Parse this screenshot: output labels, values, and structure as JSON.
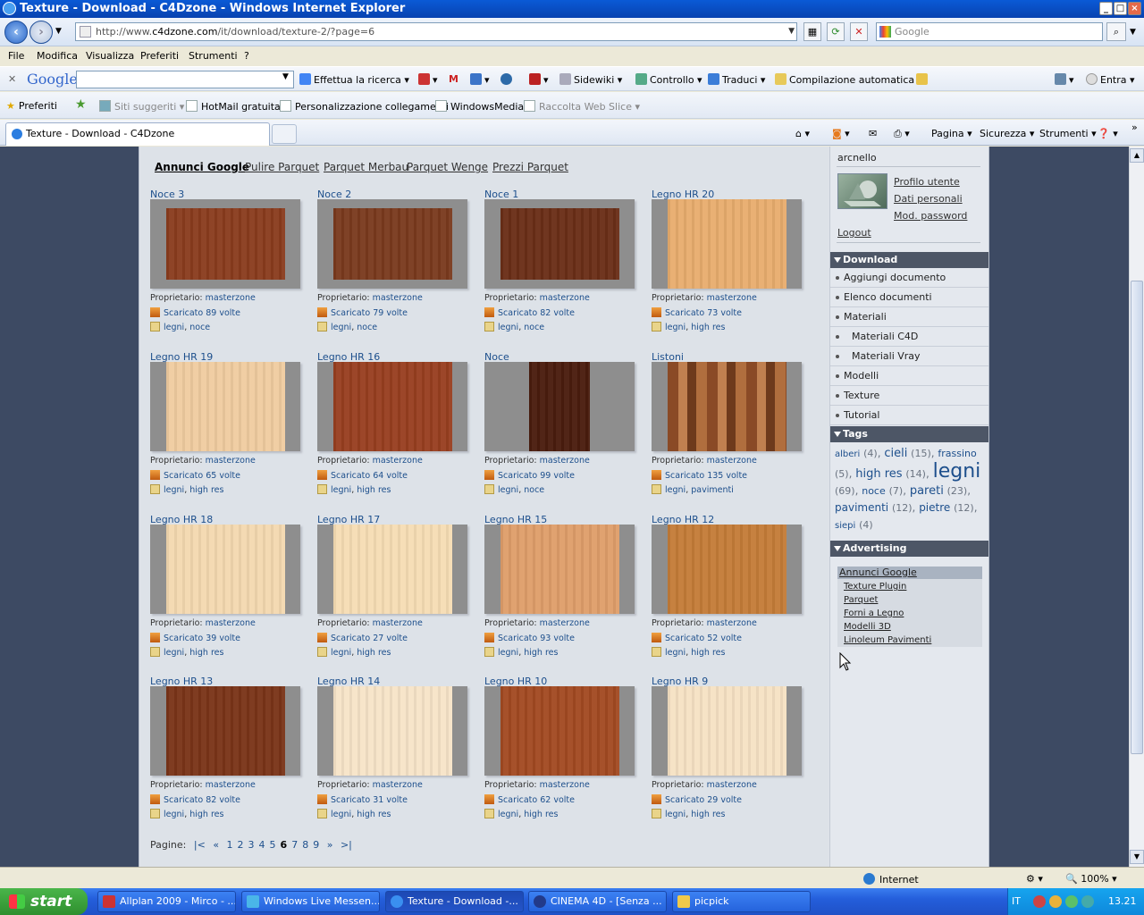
{
  "window": {
    "title": "Texture - Download - C4Dzone - Windows Internet Explorer"
  },
  "address": {
    "url_prefix": "http://www.",
    "url_domain": "c4dzone.com",
    "url_path": "/it/download/texture-2/?page=6",
    "search_placeholder": "Google"
  },
  "menu": [
    "File",
    "Modifica",
    "Visualizza",
    "Preferiti",
    "Strumenti",
    "?"
  ],
  "gtoolbar": {
    "logo": "Google",
    "search_label": "Effettua la ricerca",
    "sidewiki": "Sidewiki",
    "controllo": "Controllo",
    "traduci": "Traduci",
    "compilazione": "Compilazione automatica",
    "entra": "Entra"
  },
  "favbar": {
    "preferiti": "Preferiti",
    "siti": "Siti suggeriti",
    "hotmail": "HotMail gratuita",
    "personalizzazione": "Personalizzazione collegamenti",
    "windowsmedia": "WindowsMedia",
    "raccolta": "Raccolta Web Slice"
  },
  "tab": {
    "title": "Texture - Download - C4Dzone"
  },
  "commands": {
    "pagina": "Pagina",
    "sicurezza": "Sicurezza",
    "strumenti": "Strumenti"
  },
  "ads": {
    "label": "Annunci Google",
    "links": [
      "Pulire Parquet",
      "Parquet Merbau",
      "Parquet Wenge",
      "Prezzi Parquet"
    ]
  },
  "labels": {
    "owner": "Proprietario:",
    "owner_name": "masterzone"
  },
  "cards": [
    {
      "title": "Noce 3",
      "downloads": "Scaricato 89 volte",
      "tags": [
        "legni",
        "noce"
      ],
      "color": "#8a3c1e"
    },
    {
      "title": "Noce 2",
      "downloads": "Scaricato 79 volte",
      "tags": [
        "legni",
        "noce"
      ],
      "color": "#7a3a1e"
    },
    {
      "title": "Noce 1",
      "downloads": "Scaricato 82 volte",
      "tags": [
        "legni",
        "noce"
      ],
      "color": "#6a2e17"
    },
    {
      "title": "Legno HR 20",
      "downloads": "Scaricato 73 volte",
      "tags": [
        "legni",
        "high res"
      ],
      "color": "#e8ad6e"
    },
    {
      "title": "Legno HR 19",
      "downloads": "Scaricato 65 volte",
      "tags": [
        "legni",
        "high res"
      ],
      "color": "#f0cca0"
    },
    {
      "title": "Legno HR 16",
      "downloads": "Scaricato 64 volte",
      "tags": [
        "legni",
        "high res"
      ],
      "color": "#983f20"
    },
    {
      "title": "Noce",
      "downloads": "Scaricato 99 volte",
      "tags": [
        "legni",
        "noce"
      ],
      "color": "#4a1c0e"
    },
    {
      "title": "Listoni",
      "downloads": "Scaricato 135 volte",
      "tags": [
        "legni",
        "pavimenti"
      ],
      "color": "#a2643a"
    },
    {
      "title": "Legno HR 18",
      "downloads": "Scaricato 39 volte",
      "tags": [
        "legni",
        "high res"
      ],
      "color": "#f4d9b0"
    },
    {
      "title": "Legno HR 17",
      "downloads": "Scaricato 27 volte",
      "tags": [
        "legni",
        "high res"
      ],
      "color": "#f6ddb4"
    },
    {
      "title": "Legno HR 15",
      "downloads": "Scaricato 93 volte",
      "tags": [
        "legni",
        "high res"
      ],
      "color": "#df9e6a"
    },
    {
      "title": "Legno HR 12",
      "downloads": "Scaricato 52 volte",
      "tags": [
        "legni",
        "high res"
      ],
      "color": "#c47c38"
    },
    {
      "title": "Legno HR 13",
      "downloads": "Scaricato 82 volte",
      "tags": [
        "legni",
        "high res"
      ],
      "color": "#7a3418"
    },
    {
      "title": "Legno HR 14",
      "downloads": "Scaricato 31 volte",
      "tags": [
        "legni",
        "high res"
      ],
      "color": "#f7e4c8"
    },
    {
      "title": "Legno HR 10",
      "downloads": "Scaricato 62 volte",
      "tags": [
        "legni",
        "high res"
      ],
      "color": "#a24a22"
    },
    {
      "title": "Legno HR 9",
      "downloads": "Scaricato 29 volte",
      "tags": [
        "legni",
        "high res"
      ],
      "color": "#f6e2c4"
    }
  ],
  "pager": {
    "label": "Pagine:",
    "first": "|<",
    "prev": "«",
    "pages": [
      "1",
      "2",
      "3",
      "4",
      "5",
      "6",
      "7",
      "8",
      "9"
    ],
    "current": "6",
    "next": "»",
    "last": ">|"
  },
  "sidebar": {
    "username": "arcnello",
    "user_links": [
      "Profilo utente",
      "Dati personali",
      "Mod. password"
    ],
    "logout": "Logout",
    "download_header": "Download",
    "download_items": [
      "Aggiungi documento",
      "Elenco documenti",
      "Materiali",
      "Materiali C4D",
      "Materiali Vray",
      "Modelli",
      "Texture",
      "Tutorial"
    ],
    "tags_header": "Tags",
    "tags": [
      {
        "name": "alberi",
        "count": "(4)"
      },
      {
        "name": "cieli",
        "count": "(15)"
      },
      {
        "name": "frassino",
        "count": "(5)"
      },
      {
        "name": "high res",
        "count": "(14)"
      },
      {
        "name": "legni",
        "count": "(69)"
      },
      {
        "name": "noce",
        "count": "(7)"
      },
      {
        "name": "pareti",
        "count": "(23)"
      },
      {
        "name": "pavimenti",
        "count": "(12)"
      },
      {
        "name": "pietre",
        "count": "(12)"
      },
      {
        "name": "siepi",
        "count": "(4)"
      }
    ],
    "advertising_header": "Advertising",
    "ad_box_title": "Annunci Google",
    "ad_box_links": [
      "Texture Plugin",
      "Parquet",
      "Forni a Legno",
      "Modelli 3D",
      "Linoleum Pavimenti"
    ]
  },
  "status": {
    "zone": "Internet",
    "zoom": "100%"
  },
  "taskbar": {
    "start": "start",
    "tasks": [
      "Allplan 2009 - Mirco - ...",
      "Windows Live Messen...",
      "Texture - Download -...",
      "CINEMA 4D - [Senza ...",
      "picpick"
    ],
    "lang": "IT",
    "clock": "13.21"
  }
}
